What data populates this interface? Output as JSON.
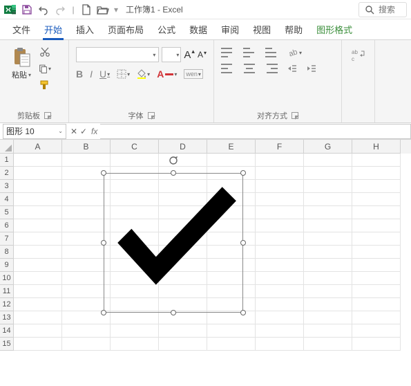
{
  "app": {
    "title": "工作簿1 - Excel"
  },
  "qat": {
    "more": "▾"
  },
  "search": {
    "placeholder": "搜索"
  },
  "tabs": {
    "file": "文件",
    "home": "开始",
    "insert": "插入",
    "layout": "页面布局",
    "formulas": "公式",
    "data": "数据",
    "review": "审阅",
    "view": "视图",
    "help": "帮助",
    "shapeformat": "图形格式"
  },
  "ribbon": {
    "clipboard": {
      "paste": "粘贴",
      "label": "剪贴板"
    },
    "font": {
      "label": "字体",
      "bold": "B",
      "italic": "I",
      "underline": "U",
      "wen": "wen"
    },
    "align": {
      "label": "对齐方式"
    }
  },
  "namebox": "图形 10",
  "fx": {
    "cancel": "✕",
    "confirm": "✓",
    "fx": "fx"
  },
  "columns": [
    "A",
    "B",
    "C",
    "D",
    "E",
    "F",
    "G",
    "H"
  ],
  "rows": [
    "1",
    "2",
    "3",
    "4",
    "5",
    "6",
    "7",
    "8",
    "9",
    "10",
    "11",
    "12",
    "13",
    "14",
    "15"
  ]
}
